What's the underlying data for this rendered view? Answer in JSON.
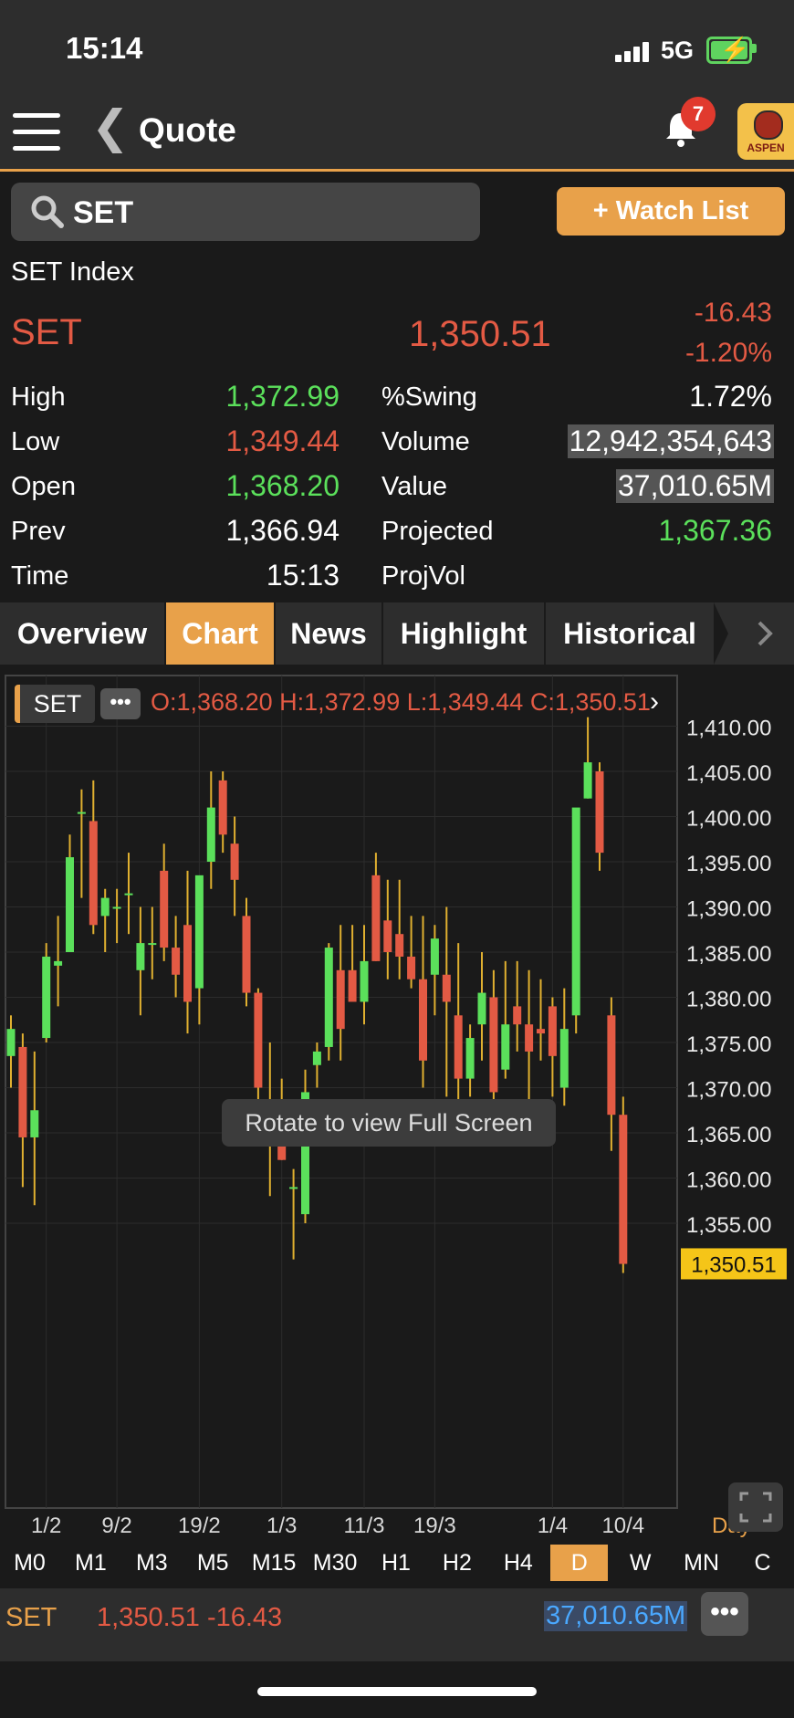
{
  "status_bar": {
    "time": "15:14",
    "network": "5G"
  },
  "header": {
    "title": "Quote",
    "notification_count": "7",
    "logo_text": "ASPEN"
  },
  "search": {
    "value": "SET",
    "watchlist_label": "+ Watch List"
  },
  "quote": {
    "name": "SET Index",
    "symbol": "SET",
    "last": "1,350.51",
    "change": "-16.43",
    "change_pct": "-1.20%",
    "left": [
      {
        "label": "High",
        "value": "1,372.99",
        "color": "green"
      },
      {
        "label": "Low",
        "value": "1,349.44",
        "color": "red"
      },
      {
        "label": "Open",
        "value": "1,368.20",
        "color": "green"
      },
      {
        "label": "Prev",
        "value": "1,366.94",
        "color": "white"
      },
      {
        "label": "Time",
        "value": "15:13",
        "color": "white"
      }
    ],
    "right": [
      {
        "label": "%Swing",
        "value": "1.72%",
        "color": "white"
      },
      {
        "label": "Volume",
        "value": "12,942,354,643",
        "color": "white"
      },
      {
        "label": "Value",
        "value": "37,010.65M",
        "color": "white"
      },
      {
        "label": "Projected",
        "value": "1,367.36",
        "color": "green"
      },
      {
        "label": "ProjVol",
        "value": "",
        "color": "white"
      }
    ]
  },
  "tabs": [
    "Overview",
    "Chart",
    "News",
    "Highlight",
    "Historical"
  ],
  "active_tab": "Chart",
  "chart_header": {
    "symbol": "SET",
    "more": "•••",
    "ohlc": "O:1,368.20  H:1,372.99  L:1,349.44  C:1,350.51"
  },
  "chart_overlay": {
    "rotate_hint": "Rotate to view Full Screen",
    "period_label": "Day"
  },
  "timeframes": [
    "M0",
    "M1",
    "M3",
    "M5",
    "M15",
    "M30",
    "H1",
    "H2",
    "H4",
    "D",
    "W",
    "MN",
    "C"
  ],
  "active_timeframe": "D",
  "bottom_bar": {
    "symbol": "SET",
    "last_change": "1,350.51 -16.43",
    "value": "37,010.65M",
    "more": "•••"
  },
  "colors": {
    "accent": "#e8a14a",
    "up": "#5be05b",
    "down": "#e35a44",
    "background": "#1a1a1a",
    "panel": "#2d2d2d"
  },
  "chart_data": {
    "type": "candlestick",
    "y_ticks": [
      "1,410.00",
      "1,405.00",
      "1,400.00",
      "1,395.00",
      "1,390.00",
      "1,385.00",
      "1,380.00",
      "1,375.00",
      "1,370.00",
      "1,365.00",
      "1,360.00",
      "1,355.00"
    ],
    "ylim": [
      1347,
      1412
    ],
    "last_price_label": "1,350.51",
    "last_price": 1350.51,
    "x_labels": [
      "1/2",
      "9/2",
      "19/2",
      "1/3",
      "11/3",
      "19/3",
      "1/4",
      "10/4"
    ],
    "x_label_candle_index": [
      3,
      9,
      16,
      23,
      30,
      36,
      46,
      52
    ],
    "candles": [
      {
        "o": 1373.5,
        "h": 1378,
        "l": 1370,
        "c": 1376.5
      },
      {
        "o": 1374.5,
        "h": 1376,
        "l": 1359,
        "c": 1364.5
      },
      {
        "o": 1364.5,
        "h": 1374,
        "l": 1357,
        "c": 1367.5
      },
      {
        "o": 1375.5,
        "h": 1386,
        "l": 1375,
        "c": 1384.5
      },
      {
        "o": 1383.5,
        "h": 1389,
        "l": 1379,
        "c": 1384
      },
      {
        "o": 1385,
        "h": 1398,
        "l": 1385,
        "c": 1395.5
      },
      {
        "o": 1400.5,
        "h": 1403,
        "l": 1391,
        "c": 1400.5
      },
      {
        "o": 1399.5,
        "h": 1404,
        "l": 1387,
        "c": 1388
      },
      {
        "o": 1389,
        "h": 1392,
        "l": 1385,
        "c": 1391
      },
      {
        "o": 1390,
        "h": 1392,
        "l": 1386,
        "c": 1390
      },
      {
        "o": 1391.5,
        "h": 1396,
        "l": 1387,
        "c": 1391.5
      },
      {
        "o": 1383,
        "h": 1390,
        "l": 1378,
        "c": 1386
      },
      {
        "o": 1386,
        "h": 1390,
        "l": 1382,
        "c": 1386
      },
      {
        "o": 1394,
        "h": 1397,
        "l": 1384,
        "c": 1385.5
      },
      {
        "o": 1385.5,
        "h": 1389,
        "l": 1380,
        "c": 1382.5
      },
      {
        "o": 1388,
        "h": 1394,
        "l": 1376,
        "c": 1379.5
      },
      {
        "o": 1381,
        "h": 1391,
        "l": 1377,
        "c": 1393.5
      },
      {
        "o": 1395,
        "h": 1405,
        "l": 1392,
        "c": 1401
      },
      {
        "o": 1404,
        "h": 1405,
        "l": 1396,
        "c": 1398
      },
      {
        "o": 1397,
        "h": 1400,
        "l": 1389,
        "c": 1393
      },
      {
        "o": 1389,
        "h": 1391,
        "l": 1379,
        "c": 1380.5
      },
      {
        "o": 1380.5,
        "h": 1381,
        "l": 1367,
        "c": 1370
      },
      {
        "o": 1367.5,
        "h": 1375,
        "l": 1358,
        "c": 1366
      },
      {
        "o": 1366,
        "h": 1371,
        "l": 1362,
        "c": 1362
      },
      {
        "o": 1359,
        "h": 1361,
        "l": 1351,
        "c": 1359
      },
      {
        "o": 1356,
        "h": 1372,
        "l": 1355,
        "c": 1369.5
      },
      {
        "o": 1372.5,
        "h": 1375,
        "l": 1370,
        "c": 1374
      },
      {
        "o": 1374.5,
        "h": 1386,
        "l": 1373,
        "c": 1385.5
      },
      {
        "o": 1383,
        "h": 1388,
        "l": 1373,
        "c": 1376.5
      },
      {
        "o": 1383,
        "h": 1388,
        "l": 1380,
        "c": 1379.5
      },
      {
        "o": 1379.5,
        "h": 1388,
        "l": 1377,
        "c": 1384
      },
      {
        "o": 1393.5,
        "h": 1396,
        "l": 1384,
        "c": 1384
      },
      {
        "o": 1388.5,
        "h": 1393,
        "l": 1382,
        "c": 1385
      },
      {
        "o": 1387,
        "h": 1393,
        "l": 1382,
        "c": 1384.5
      },
      {
        "o": 1384.5,
        "h": 1389,
        "l": 1381,
        "c": 1382
      },
      {
        "o": 1382,
        "h": 1389,
        "l": 1370,
        "c": 1373
      },
      {
        "o": 1382.5,
        "h": 1388,
        "l": 1378,
        "c": 1386.5
      },
      {
        "o": 1382.5,
        "h": 1390,
        "l": 1369,
        "c": 1379.5
      },
      {
        "o": 1378,
        "h": 1386,
        "l": 1368,
        "c": 1371
      },
      {
        "o": 1371,
        "h": 1377,
        "l": 1369,
        "c": 1375.5
      },
      {
        "o": 1377,
        "h": 1385,
        "l": 1373,
        "c": 1380.5
      },
      {
        "o": 1380,
        "h": 1383,
        "l": 1368,
        "c": 1369.5
      },
      {
        "o": 1372,
        "h": 1384,
        "l": 1371,
        "c": 1377
      },
      {
        "o": 1379,
        "h": 1384,
        "l": 1374,
        "c": 1377
      },
      {
        "o": 1377,
        "h": 1383,
        "l": 1368,
        "c": 1374
      },
      {
        "o": 1376.5,
        "h": 1382,
        "l": 1373,
        "c": 1376
      },
      {
        "o": 1379,
        "h": 1380,
        "l": 1369,
        "c": 1373.5
      },
      {
        "o": 1370,
        "h": 1381,
        "l": 1368,
        "c": 1376.5
      },
      {
        "o": 1378,
        "h": 1395,
        "l": 1376,
        "c": 1401
      },
      {
        "o": 1402,
        "h": 1411,
        "l": 1402,
        "c": 1406
      },
      {
        "o": 1405,
        "h": 1406,
        "l": 1394,
        "c": 1396
      },
      {
        "o": 1378,
        "h": 1380,
        "l": 1363,
        "c": 1367
      },
      {
        "o": 1367,
        "h": 1369,
        "l": 1349.5,
        "c": 1350.5
      }
    ]
  }
}
